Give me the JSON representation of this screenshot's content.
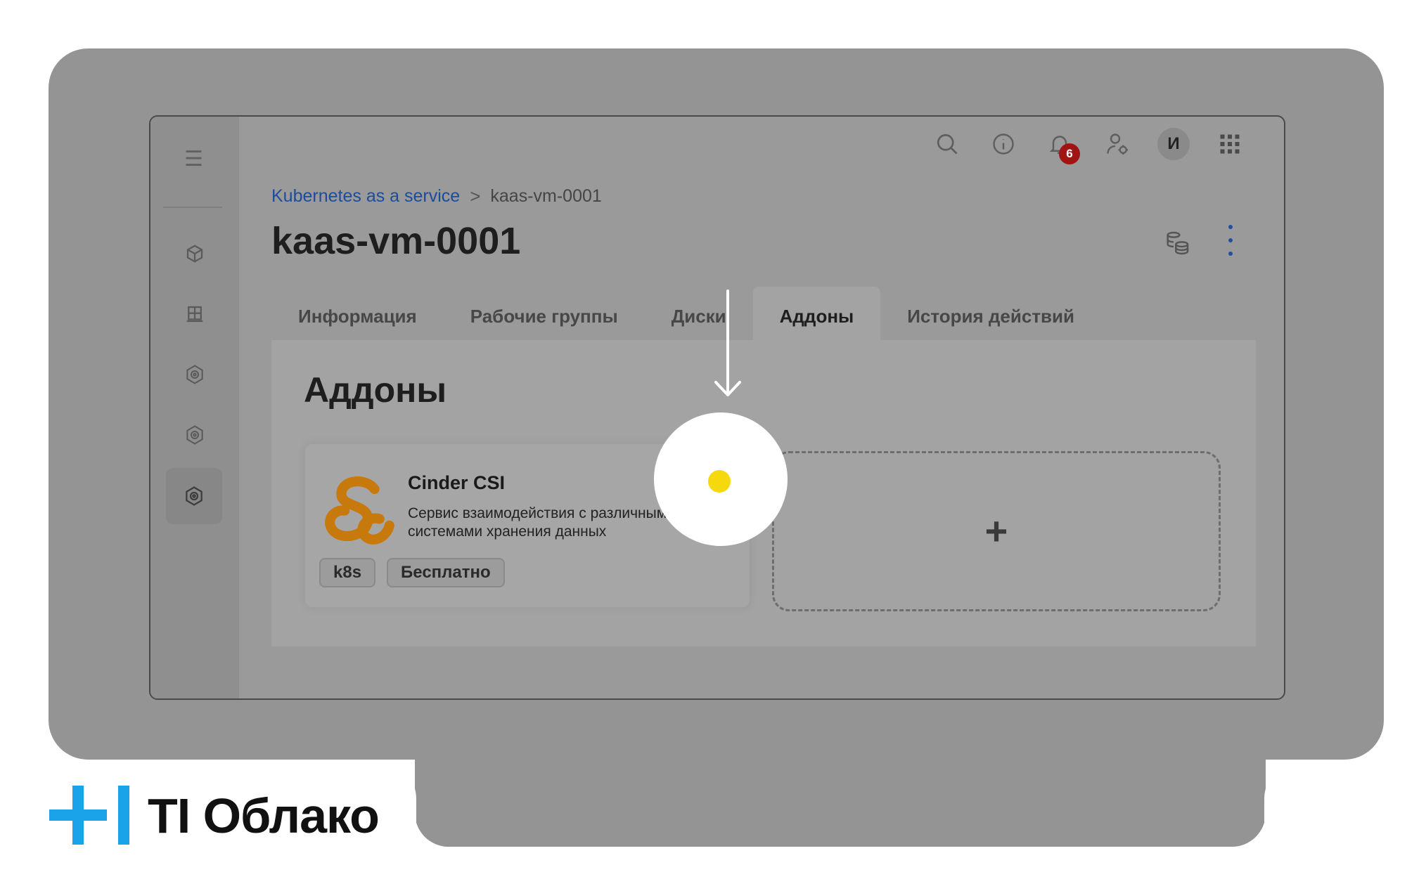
{
  "colors": {
    "backdrop": "#949494",
    "link": "#1c4c9c",
    "badge": "#a11414",
    "status_dot": "#f5d90d",
    "brand_accent": "#1aa3e8",
    "addon_logo": "#d9860c"
  },
  "topbar": {
    "icons": [
      "search-icon",
      "info-icon",
      "bell-icon",
      "user-settings-icon",
      "apps-grid-icon"
    ],
    "notification_count": "6",
    "avatar_initial": "И"
  },
  "sidebar": {
    "icons": [
      "menu-icon",
      "cube-icon",
      "table-icon",
      "gear-icon",
      "gear-icon",
      "gear-icon"
    ]
  },
  "breadcrumb": {
    "root": "Kubernetes as a service",
    "separator": ">",
    "current": "kaas-vm-0001"
  },
  "page": {
    "title": "kaas-vm-0001"
  },
  "tabs": [
    {
      "label": "Информация"
    },
    {
      "label": "Рабочие группы"
    },
    {
      "label": "Диски"
    },
    {
      "label": "Аддоны",
      "active": true
    },
    {
      "label": "История действий"
    }
  ],
  "panel": {
    "title": "Аддоны",
    "addon": {
      "name": "Cinder CSI",
      "description_line1": "Сервис взаимодействия с различными",
      "description_line2": "системами хранения данных",
      "tags": [
        "k8s",
        "Бесплатно"
      ],
      "status": "yellow"
    },
    "add_button": "+"
  },
  "brand": {
    "name": "TI Облако"
  }
}
